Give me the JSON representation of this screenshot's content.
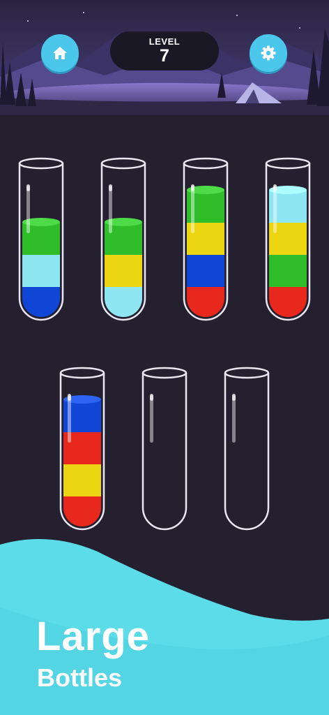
{
  "header": {
    "level_label": "LEVEL",
    "level_number": "7",
    "home_icon": "home-icon",
    "settings_icon": "gear-icon"
  },
  "colors": {
    "green": "#2fbe2a",
    "light_blue": "#8de6f2",
    "blue": "#1046d6",
    "yellow": "#ecd612",
    "red": "#e8281c",
    "button": "#4cc7ec",
    "wave": "#5cdbe9",
    "background": "#24202f"
  },
  "bottles": [
    {
      "name": "bottle-1",
      "layers_bottom_to_top": [
        "blue",
        "light_blue",
        "green"
      ]
    },
    {
      "name": "bottle-2",
      "layers_bottom_to_top": [
        "light_blue",
        "yellow",
        "green"
      ]
    },
    {
      "name": "bottle-3",
      "layers_bottom_to_top": [
        "red",
        "blue",
        "yellow",
        "green"
      ]
    },
    {
      "name": "bottle-4",
      "layers_bottom_to_top": [
        "red",
        "green",
        "yellow",
        "light_blue"
      ]
    },
    {
      "name": "bottle-5",
      "layers_bottom_to_top": [
        "red",
        "yellow",
        "red",
        "blue"
      ]
    },
    {
      "name": "bottle-6",
      "layers_bottom_to_top": []
    },
    {
      "name": "bottle-7",
      "layers_bottom_to_top": []
    }
  ],
  "caption": {
    "line1": "Large",
    "line2": "Bottles"
  }
}
